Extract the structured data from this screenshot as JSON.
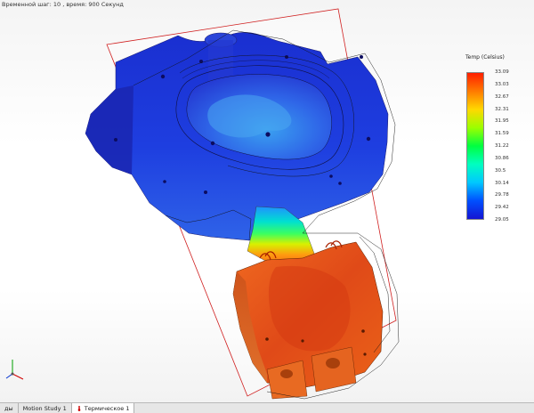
{
  "viewport": {
    "caption": "Временной шаг: 10 , время: 900 Секунд"
  },
  "legend": {
    "title": "Temp (Celsius)",
    "gradient": [
      "#ff1e00",
      "#ff7a00",
      "#ffd800",
      "#9cff00",
      "#00ff40",
      "#00ffc0",
      "#00c8ff",
      "#0050ff",
      "#1414d2"
    ],
    "labels": [
      "33.09",
      "33.03",
      "32.67",
      "32.31",
      "31.95",
      "31.59",
      "31.22",
      "30.86",
      "30.5",
      "30.14",
      "29.78",
      "29.42",
      "29.05"
    ]
  },
  "tabs": [
    {
      "label": "ды",
      "active": false,
      "icon": "none"
    },
    {
      "label": "Motion Study 1",
      "active": false,
      "icon": "none"
    },
    {
      "label": "Термическое 1",
      "active": true,
      "icon": "thermal-study-icon"
    }
  ],
  "colors": {
    "cold": "#1a3fd4",
    "hot": "#e0601c",
    "section_plane": "#d02020"
  }
}
